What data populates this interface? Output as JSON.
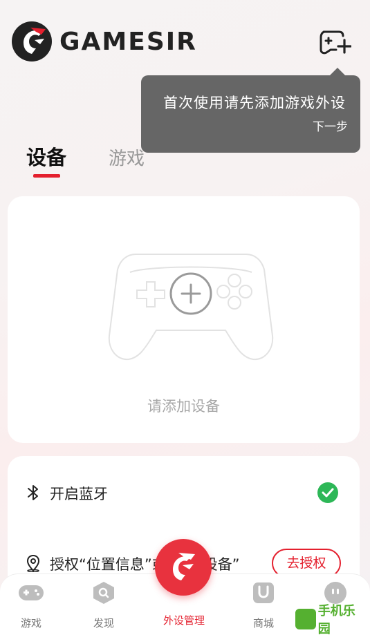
{
  "brand": {
    "name": "GAMESIR"
  },
  "tooltip": {
    "text": "首次使用请先添加游戏外设",
    "next": "下一步"
  },
  "tabs": [
    {
      "label": "设备",
      "active": true
    },
    {
      "label": "游戏",
      "active": false
    }
  ],
  "empty": {
    "text": "请添加设备"
  },
  "permissions": {
    "bluetooth": {
      "label": "开启蓝牙",
      "enabled": true
    },
    "location": {
      "label": "授权“位置信息”或“附近设备”",
      "button": "去授权"
    }
  },
  "nav": [
    {
      "label": "游戏"
    },
    {
      "label": "发现"
    },
    {
      "label": "外设管理",
      "active": true
    },
    {
      "label": "商城"
    },
    {
      "label": ""
    }
  ],
  "watermark": {
    "text": "手机乐园"
  },
  "colors": {
    "accent": "#e4202e",
    "success": "#2db757",
    "tooltip_bg": "#666666"
  }
}
